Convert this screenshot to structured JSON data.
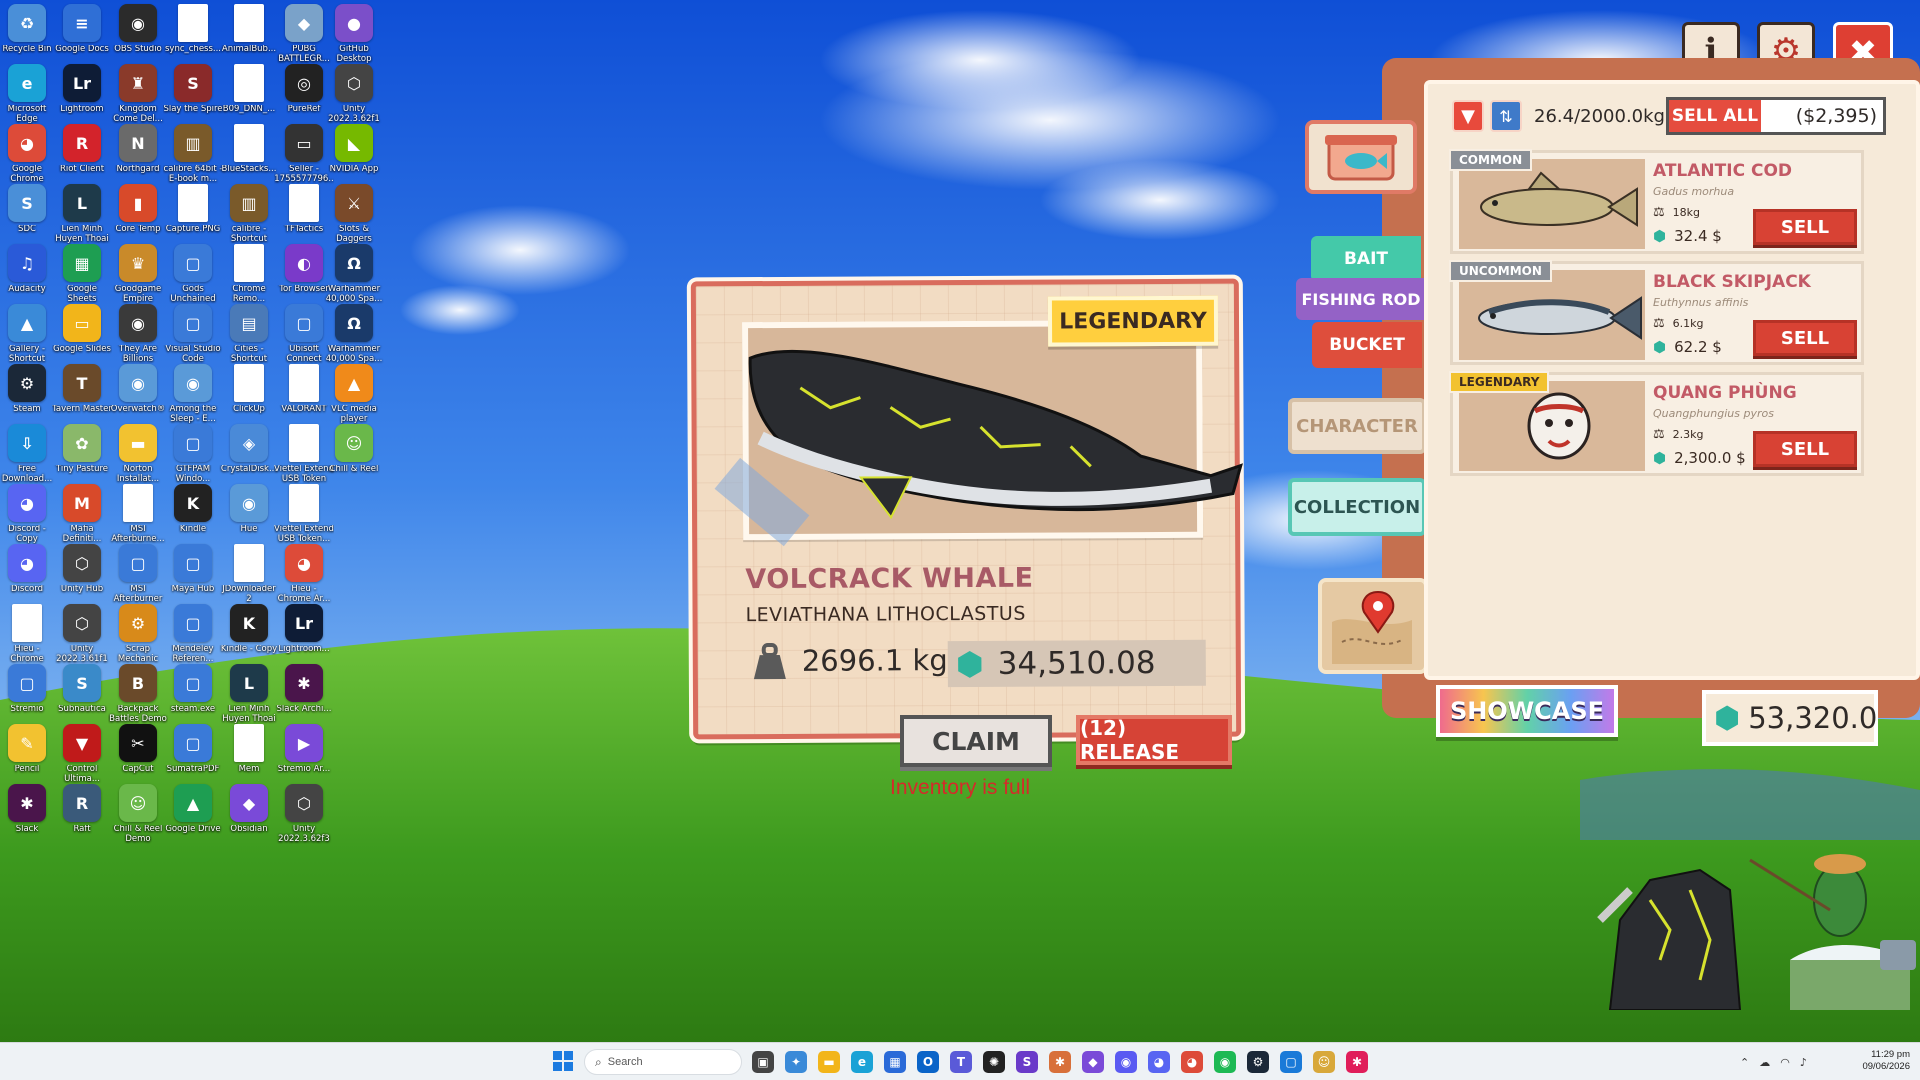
{
  "desktop_icons": [
    {
      "label": "Recycle Bin",
      "glyph": "♻",
      "color": "#4a8fd8"
    },
    {
      "label": "Google Docs",
      "glyph": "≡",
      "color": "#2f6fd6"
    },
    {
      "label": "OBS Studio",
      "glyph": "◉",
      "color": "#2b2b2b"
    },
    {
      "label": "sync_chess...",
      "glyph": "",
      "color": "doc"
    },
    {
      "label": "AnimalBub...",
      "glyph": "",
      "color": "doc"
    },
    {
      "label": "PUBG BATTLEGR...",
      "glyph": "◆",
      "color": "#7aa2c9"
    },
    {
      "label": "GitHub Desktop",
      "glyph": "●",
      "color": "#7b4fc9"
    },
    {
      "label": "Microsoft Edge",
      "glyph": "e",
      "color": "#1aa2d6"
    },
    {
      "label": "Lightroom",
      "glyph": "Lr",
      "color": "#0e1c36"
    },
    {
      "label": "Kingdom Come Del...",
      "glyph": "♜",
      "color": "#8a3a2a"
    },
    {
      "label": "Slay the Spire",
      "glyph": "S",
      "color": "#8a2a2a"
    },
    {
      "label": "B09_DNN_...",
      "glyph": "",
      "color": "doc"
    },
    {
      "label": "PureRef",
      "glyph": "◎",
      "color": "#222"
    },
    {
      "label": "Unity 2022.3.62f1",
      "glyph": "⬡",
      "color": "#444"
    },
    {
      "label": "Google Chrome",
      "glyph": "◕",
      "color": "#dd4b39"
    },
    {
      "label": "Riot Client",
      "glyph": "R",
      "color": "#d3232b"
    },
    {
      "label": "Northgard",
      "glyph": "N",
      "color": "#6a6a6a"
    },
    {
      "label": "calibre 64bit - E-book m...",
      "glyph": "▥",
      "color": "#7a5a2a"
    },
    {
      "label": "BlueStacks...",
      "glyph": "",
      "color": "doc"
    },
    {
      "label": "Seller - 1755577796...",
      "glyph": "▭",
      "color": "#333"
    },
    {
      "label": "NVIDIA App",
      "glyph": "◣",
      "color": "#76b900"
    },
    {
      "label": "SDC",
      "glyph": "S",
      "color": "#4a8fd8"
    },
    {
      "label": "Lien Minh Huyen Thoai",
      "glyph": "L",
      "color": "#1e3a4a"
    },
    {
      "label": "Core Temp",
      "glyph": "▮",
      "color": "#d84a2a"
    },
    {
      "label": "Capture.PNG",
      "glyph": "",
      "color": "doc"
    },
    {
      "label": "calibre - Shortcut",
      "glyph": "▥",
      "color": "#7a5a2a"
    },
    {
      "label": "TFTactics",
      "glyph": "",
      "color": "doc"
    },
    {
      "label": "Slots & Daggers",
      "glyph": "⚔",
      "color": "#7a4a2a"
    },
    {
      "label": "Audacity",
      "glyph": "♫",
      "color": "#2a5ad8"
    },
    {
      "label": "Google Sheets",
      "glyph": "▦",
      "color": "#1e9e52"
    },
    {
      "label": "Goodgame Empire",
      "glyph": "♛",
      "color": "#c98a2a"
    },
    {
      "label": "Gods Unchained",
      "glyph": "▢",
      "color": "#3a7ad8"
    },
    {
      "label": "Chrome Remo...",
      "glyph": "",
      "color": "doc"
    },
    {
      "label": "Tor Browser",
      "glyph": "◐",
      "color": "#7a3ac9"
    },
    {
      "label": "Warhammer 40,000 Spa...",
      "glyph": "Ω",
      "color": "#1a3a6a"
    },
    {
      "label": "Gallery - Shortcut",
      "glyph": "▲",
      "color": "#3a8ad8"
    },
    {
      "label": "Google Slides",
      "glyph": "▭",
      "color": "#f2b51a"
    },
    {
      "label": "They Are Billions",
      "glyph": "◉",
      "color": "#3a3a3a"
    },
    {
      "label": "Visual Studio Code",
      "glyph": "▢",
      "color": "#3a7ad8"
    },
    {
      "label": "Cities - Shortcut",
      "glyph": "▤",
      "color": "#4a7ab8"
    },
    {
      "label": "Ubisoft Connect",
      "glyph": "▢",
      "color": "#3a7ad8"
    },
    {
      "label": "Warhammer 40,000 Spa...",
      "glyph": "Ω",
      "color": "#1a3a6a"
    },
    {
      "label": "Steam",
      "glyph": "⚙",
      "color": "#1b2838"
    },
    {
      "label": "Tavern Master",
      "glyph": "T",
      "color": "#6a4a2a"
    },
    {
      "label": "Overwatch®",
      "glyph": "◉",
      "color": "#5a9ad8"
    },
    {
      "label": "Among the Sleep - E...",
      "glyph": "◉",
      "color": "#5a9ad8"
    },
    {
      "label": "ClickUp",
      "glyph": "",
      "color": "doc"
    },
    {
      "label": "VALORANT",
      "glyph": "",
      "color": "doc"
    },
    {
      "label": "VLC media player",
      "glyph": "▲",
      "color": "#f08a1a"
    },
    {
      "label": "Free Download...",
      "glyph": "⇩",
      "color": "#1a8ad8"
    },
    {
      "label": "Tiny Pasture",
      "glyph": "✿",
      "color": "#8ab86a"
    },
    {
      "label": "Norton Installat...",
      "glyph": "▬",
      "color": "#f2c230"
    },
    {
      "label": "GTFPAM Windo...",
      "glyph": "▢",
      "color": "#3a7ad8"
    },
    {
      "label": "CrystalDisk...",
      "glyph": "◈",
      "color": "#4a8ad8"
    },
    {
      "label": "Viettel Extend USB Token",
      "glyph": "",
      "color": "doc"
    },
    {
      "label": "Chill & Reel",
      "glyph": "☺",
      "color": "#6ab84a"
    },
    {
      "label": "Discord - Copy",
      "glyph": "◕",
      "color": "#5865f2"
    },
    {
      "label": "Mafia Definiti...",
      "glyph": "M",
      "color": "#d84a2a"
    },
    {
      "label": "MSI Afterburne...",
      "glyph": "",
      "color": "doc"
    },
    {
      "label": "Kindle",
      "glyph": "K",
      "color": "#222"
    },
    {
      "label": "Hue",
      "glyph": "◉",
      "color": "#5a9ad8"
    },
    {
      "label": "Viettel Extend USB Token...",
      "glyph": "",
      "color": "doc"
    },
    {
      "label": "Discord",
      "glyph": "◕",
      "color": "#5865f2"
    },
    {
      "label": "Unity Hub",
      "glyph": "⬡",
      "color": "#444"
    },
    {
      "label": "MSI Afterburner",
      "glyph": "▢",
      "color": "#3a7ad8"
    },
    {
      "label": "Maya Hub",
      "glyph": "▢",
      "color": "#3a7ad8"
    },
    {
      "label": "JDownloader 2",
      "glyph": "",
      "color": "doc"
    },
    {
      "label": "Hieu - Chrome Ar...",
      "glyph": "◕",
      "color": "#dd4b39"
    },
    {
      "label": "Hieu - Chrome",
      "glyph": "",
      "color": "doc"
    },
    {
      "label": "Unity 2022.3.61f1",
      "glyph": "⬡",
      "color": "#444"
    },
    {
      "label": "Scrap Mechanic",
      "glyph": "⚙",
      "color": "#d88a1a"
    },
    {
      "label": "Mendeley Referen...",
      "glyph": "▢",
      "color": "#3a7ad8"
    },
    {
      "label": "Kindle - Copy",
      "glyph": "K",
      "color": "#222"
    },
    {
      "label": "Lightroom...",
      "glyph": "Lr",
      "color": "#0e1c36"
    },
    {
      "label": "Stremio",
      "glyph": "▢",
      "color": "#3a7ad8"
    },
    {
      "label": "Subnautica",
      "glyph": "S",
      "color": "#3a8ac9"
    },
    {
      "label": "Backpack Battles Demo",
      "glyph": "B",
      "color": "#6a4a2a"
    },
    {
      "label": "steam.exe",
      "glyph": "▢",
      "color": "#3a7ad8"
    },
    {
      "label": "Lien Minh Huyen Thoai",
      "glyph": "L",
      "color": "#1e3a4a"
    },
    {
      "label": "Slack Archi...",
      "glyph": "✱",
      "color": "#4a154b"
    },
    {
      "label": "Pencil",
      "glyph": "✎",
      "color": "#f2c230"
    },
    {
      "label": "Control Ultima...",
      "glyph": "▼",
      "color": "#c01a1a"
    },
    {
      "label": "CapCut",
      "glyph": "✂",
      "color": "#111"
    },
    {
      "label": "SumatraPDF",
      "glyph": "▢",
      "color": "#3a7ad8"
    },
    {
      "label": "Mem",
      "glyph": "",
      "color": "doc"
    },
    {
      "label": "Stremio Ar...",
      "glyph": "▶",
      "color": "#7a4ad8"
    },
    {
      "label": "Slack",
      "glyph": "✱",
      "color": "#4a154b"
    },
    {
      "label": "Raft",
      "glyph": "R",
      "color": "#3a5a7a"
    },
    {
      "label": "Chill & Reel Demo",
      "glyph": "☺",
      "color": "#6ab84a"
    },
    {
      "label": "Google Drive",
      "glyph": "▲",
      "color": "#1e9e52"
    },
    {
      "label": "Obsidian",
      "glyph": "◆",
      "color": "#7a4ad8"
    },
    {
      "label": "Unity 2022.3.62f3",
      "glyph": "⬡",
      "color": "#444"
    }
  ],
  "game": {
    "top_buttons": {
      "info": "i",
      "settings": "⚙",
      "close": "✖"
    },
    "catch": {
      "rarity": "LEGENDARY",
      "name": "VOLCRACK WHALE",
      "latin": "LEVIATHANA LITHOCLASTUS",
      "weight": "2696.1 kg",
      "value": "34,510.08",
      "claim_label": "CLAIM",
      "release_label": "(12) RELEASE",
      "status_message": "Inventory is full"
    },
    "tabs": {
      "bait": "BAIT",
      "fishing_rod": "FISHING ROD",
      "bucket": "BUCKET",
      "character": "CHARACTER",
      "collection": "COLLECTION"
    },
    "bucket": {
      "capacity": "26.4/2000.0kg",
      "sell_all_label": "SELL ALL",
      "sell_all_total": "($2,395)",
      "items": [
        {
          "rarity": "COMMON",
          "rarity_color": "#8a8f96",
          "name": "ATLANTIC COD",
          "latin": "Gadus morhua",
          "weight": "18kg",
          "price": "32.4 $",
          "sell_label": "SELL"
        },
        {
          "rarity": "UNCOMMON",
          "rarity_color": "#8a8f96",
          "name": "BLACK SKIPJACK",
          "latin": "Euthynnus affinis",
          "weight": "6.1kg",
          "price": "62.2 $",
          "sell_label": "SELL"
        },
        {
          "rarity": "LEGENDARY",
          "rarity_color": "#f2c230",
          "name": "QUANG PHÙNG",
          "latin": "Quangphungius pyros",
          "weight": "2.3kg",
          "price": "2,300.0 $",
          "sell_label": "SELL"
        }
      ]
    },
    "showcase_label": "SHOWCASE",
    "gem_balance": "53,320.0"
  },
  "taskbar": {
    "search_placeholder": "Search",
    "apps": [
      {
        "name": "task-view",
        "glyph": "▣",
        "color": "#444"
      },
      {
        "name": "copilot",
        "glyph": "✦",
        "color": "#3a8ad8"
      },
      {
        "name": "file-explorer",
        "glyph": "▬",
        "color": "#f2b51a"
      },
      {
        "name": "edge",
        "glyph": "e",
        "color": "#1aa2d6"
      },
      {
        "name": "store",
        "glyph": "▦",
        "color": "#2a6ad8"
      },
      {
        "name": "outlook",
        "glyph": "O",
        "color": "#0a64c8"
      },
      {
        "name": "teams",
        "glyph": "T",
        "color": "#5a5ad8"
      },
      {
        "name": "chatgpt",
        "glyph": "✺",
        "color": "#222"
      },
      {
        "name": "visual-studio",
        "glyph": "S",
        "color": "#6a3ac9"
      },
      {
        "name": "claude",
        "glyph": "✱",
        "color": "#d8703a"
      },
      {
        "name": "app-purple",
        "glyph": "◆",
        "color": "#7a4ad8"
      },
      {
        "name": "messenger",
        "glyph": "◉",
        "color": "#5a5af2"
      },
      {
        "name": "discord",
        "glyph": "◕",
        "color": "#5865f2"
      },
      {
        "name": "chrome",
        "glyph": "◕",
        "color": "#dd4b39"
      },
      {
        "name": "spotify",
        "glyph": "◉",
        "color": "#1db954"
      },
      {
        "name": "steam",
        "glyph": "⚙",
        "color": "#1b2838"
      },
      {
        "name": "vscode",
        "glyph": "▢",
        "color": "#1a7ad8"
      },
      {
        "name": "chill-and-reel",
        "glyph": "☺",
        "color": "#d8a83a"
      },
      {
        "name": "slack",
        "glyph": "✱",
        "color": "#e01e5a"
      }
    ],
    "time": "11:29 pm",
    "date": "09/06/2026"
  }
}
